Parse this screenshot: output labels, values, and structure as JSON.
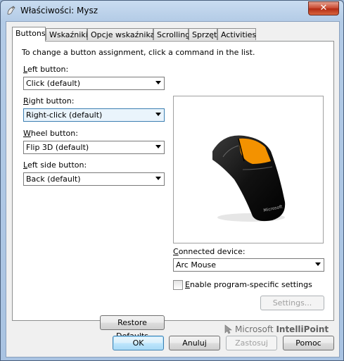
{
  "window": {
    "title": "Właściwości: Mysz",
    "close_glyph": "✕"
  },
  "tabs": [
    {
      "label": "Buttons",
      "active": true
    },
    {
      "label": "Wskaźniki",
      "active": false
    },
    {
      "label": "Opcje wskaźnika",
      "active": false
    },
    {
      "label": "Scrolling",
      "active": false
    },
    {
      "label": "Sprzęt",
      "active": false
    },
    {
      "label": "Activities",
      "active": false
    }
  ],
  "buttons_tab": {
    "hint": "To change a button assignment, click a command in the list.",
    "assignments": [
      {
        "label_key": "L",
        "label_rest": "eft button:",
        "value": "Click (default)"
      },
      {
        "label_key": "R",
        "label_rest": "ight button:",
        "value": "Right-click (default)"
      },
      {
        "label_key": "W",
        "label_rest": "heel button:",
        "value": "Flip 3D (default)"
      },
      {
        "label_key": "L",
        "label_rest": "eft side button:",
        "value": "Back (default)"
      }
    ],
    "connected_device": {
      "label_key": "C",
      "label_rest": "onnected device:",
      "value": "Arc Mouse"
    },
    "program_specific": {
      "label_key": "E",
      "label_rest": "nable program-specific settings",
      "checked": false
    },
    "settings_button": "Settings...",
    "restore_defaults_button": "Restore Defaults",
    "brand": {
      "prefix": "Microsoft ",
      "product": "IntelliPoint"
    },
    "mouse_logo_text": "Microsoft"
  },
  "dialog_buttons": {
    "ok": "OK",
    "cancel": "Anuluj",
    "apply": "Zastosuj",
    "help": "Pomoc"
  },
  "colors": {
    "accent_orange": "#f39200",
    "mouse_black": "#1a1a1a"
  }
}
